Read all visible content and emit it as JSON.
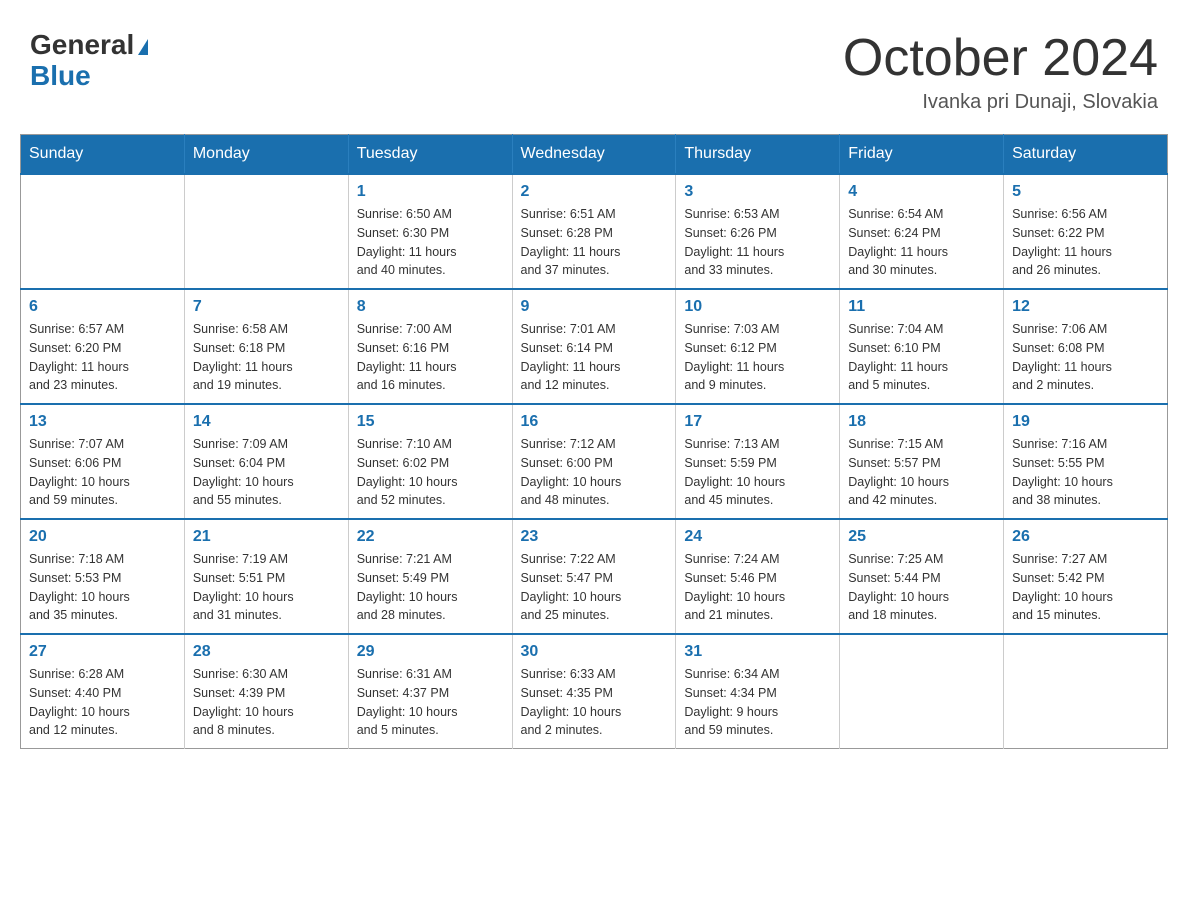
{
  "header": {
    "logo_general": "General",
    "logo_blue": "Blue",
    "month_title": "October 2024",
    "location": "Ivanka pri Dunaji, Slovakia"
  },
  "weekdays": [
    "Sunday",
    "Monday",
    "Tuesday",
    "Wednesday",
    "Thursday",
    "Friday",
    "Saturday"
  ],
  "weeks": [
    [
      {
        "day": "",
        "info": ""
      },
      {
        "day": "",
        "info": ""
      },
      {
        "day": "1",
        "info": "Sunrise: 6:50 AM\nSunset: 6:30 PM\nDaylight: 11 hours\nand 40 minutes."
      },
      {
        "day": "2",
        "info": "Sunrise: 6:51 AM\nSunset: 6:28 PM\nDaylight: 11 hours\nand 37 minutes."
      },
      {
        "day": "3",
        "info": "Sunrise: 6:53 AM\nSunset: 6:26 PM\nDaylight: 11 hours\nand 33 minutes."
      },
      {
        "day": "4",
        "info": "Sunrise: 6:54 AM\nSunset: 6:24 PM\nDaylight: 11 hours\nand 30 minutes."
      },
      {
        "day": "5",
        "info": "Sunrise: 6:56 AM\nSunset: 6:22 PM\nDaylight: 11 hours\nand 26 minutes."
      }
    ],
    [
      {
        "day": "6",
        "info": "Sunrise: 6:57 AM\nSunset: 6:20 PM\nDaylight: 11 hours\nand 23 minutes."
      },
      {
        "day": "7",
        "info": "Sunrise: 6:58 AM\nSunset: 6:18 PM\nDaylight: 11 hours\nand 19 minutes."
      },
      {
        "day": "8",
        "info": "Sunrise: 7:00 AM\nSunset: 6:16 PM\nDaylight: 11 hours\nand 16 minutes."
      },
      {
        "day": "9",
        "info": "Sunrise: 7:01 AM\nSunset: 6:14 PM\nDaylight: 11 hours\nand 12 minutes."
      },
      {
        "day": "10",
        "info": "Sunrise: 7:03 AM\nSunset: 6:12 PM\nDaylight: 11 hours\nand 9 minutes."
      },
      {
        "day": "11",
        "info": "Sunrise: 7:04 AM\nSunset: 6:10 PM\nDaylight: 11 hours\nand 5 minutes."
      },
      {
        "day": "12",
        "info": "Sunrise: 7:06 AM\nSunset: 6:08 PM\nDaylight: 11 hours\nand 2 minutes."
      }
    ],
    [
      {
        "day": "13",
        "info": "Sunrise: 7:07 AM\nSunset: 6:06 PM\nDaylight: 10 hours\nand 59 minutes."
      },
      {
        "day": "14",
        "info": "Sunrise: 7:09 AM\nSunset: 6:04 PM\nDaylight: 10 hours\nand 55 minutes."
      },
      {
        "day": "15",
        "info": "Sunrise: 7:10 AM\nSunset: 6:02 PM\nDaylight: 10 hours\nand 52 minutes."
      },
      {
        "day": "16",
        "info": "Sunrise: 7:12 AM\nSunset: 6:00 PM\nDaylight: 10 hours\nand 48 minutes."
      },
      {
        "day": "17",
        "info": "Sunrise: 7:13 AM\nSunset: 5:59 PM\nDaylight: 10 hours\nand 45 minutes."
      },
      {
        "day": "18",
        "info": "Sunrise: 7:15 AM\nSunset: 5:57 PM\nDaylight: 10 hours\nand 42 minutes."
      },
      {
        "day": "19",
        "info": "Sunrise: 7:16 AM\nSunset: 5:55 PM\nDaylight: 10 hours\nand 38 minutes."
      }
    ],
    [
      {
        "day": "20",
        "info": "Sunrise: 7:18 AM\nSunset: 5:53 PM\nDaylight: 10 hours\nand 35 minutes."
      },
      {
        "day": "21",
        "info": "Sunrise: 7:19 AM\nSunset: 5:51 PM\nDaylight: 10 hours\nand 31 minutes."
      },
      {
        "day": "22",
        "info": "Sunrise: 7:21 AM\nSunset: 5:49 PM\nDaylight: 10 hours\nand 28 minutes."
      },
      {
        "day": "23",
        "info": "Sunrise: 7:22 AM\nSunset: 5:47 PM\nDaylight: 10 hours\nand 25 minutes."
      },
      {
        "day": "24",
        "info": "Sunrise: 7:24 AM\nSunset: 5:46 PM\nDaylight: 10 hours\nand 21 minutes."
      },
      {
        "day": "25",
        "info": "Sunrise: 7:25 AM\nSunset: 5:44 PM\nDaylight: 10 hours\nand 18 minutes."
      },
      {
        "day": "26",
        "info": "Sunrise: 7:27 AM\nSunset: 5:42 PM\nDaylight: 10 hours\nand 15 minutes."
      }
    ],
    [
      {
        "day": "27",
        "info": "Sunrise: 6:28 AM\nSunset: 4:40 PM\nDaylight: 10 hours\nand 12 minutes."
      },
      {
        "day": "28",
        "info": "Sunrise: 6:30 AM\nSunset: 4:39 PM\nDaylight: 10 hours\nand 8 minutes."
      },
      {
        "day": "29",
        "info": "Sunrise: 6:31 AM\nSunset: 4:37 PM\nDaylight: 10 hours\nand 5 minutes."
      },
      {
        "day": "30",
        "info": "Sunrise: 6:33 AM\nSunset: 4:35 PM\nDaylight: 10 hours\nand 2 minutes."
      },
      {
        "day": "31",
        "info": "Sunrise: 6:34 AM\nSunset: 4:34 PM\nDaylight: 9 hours\nand 59 minutes."
      },
      {
        "day": "",
        "info": ""
      },
      {
        "day": "",
        "info": ""
      }
    ]
  ]
}
